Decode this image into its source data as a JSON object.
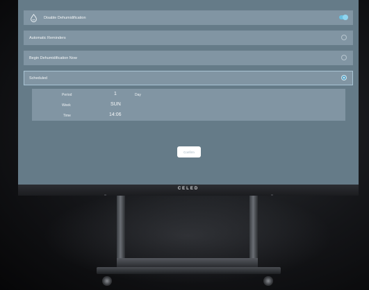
{
  "device": {
    "brand": "CELED"
  },
  "settings": {
    "disable_label": "Disable Dehumidification",
    "disable_enabled": true,
    "options": [
      {
        "label": "Automatic Reminders",
        "selected": false
      },
      {
        "label": "Begin Dehumidification Now",
        "selected": false
      },
      {
        "label": "Scheduled",
        "selected": true
      }
    ]
  },
  "schedule": {
    "period_label": "Period",
    "period_value": "1",
    "period_unit": "Day",
    "week_label": "Week",
    "week_value": "SUN",
    "time_label": "Time",
    "time_value": "14:06"
  },
  "confirm_label": "Confirm",
  "colors": {
    "screen": "#657b88",
    "row": "#8195a3",
    "accent": "#6cc0e0"
  }
}
